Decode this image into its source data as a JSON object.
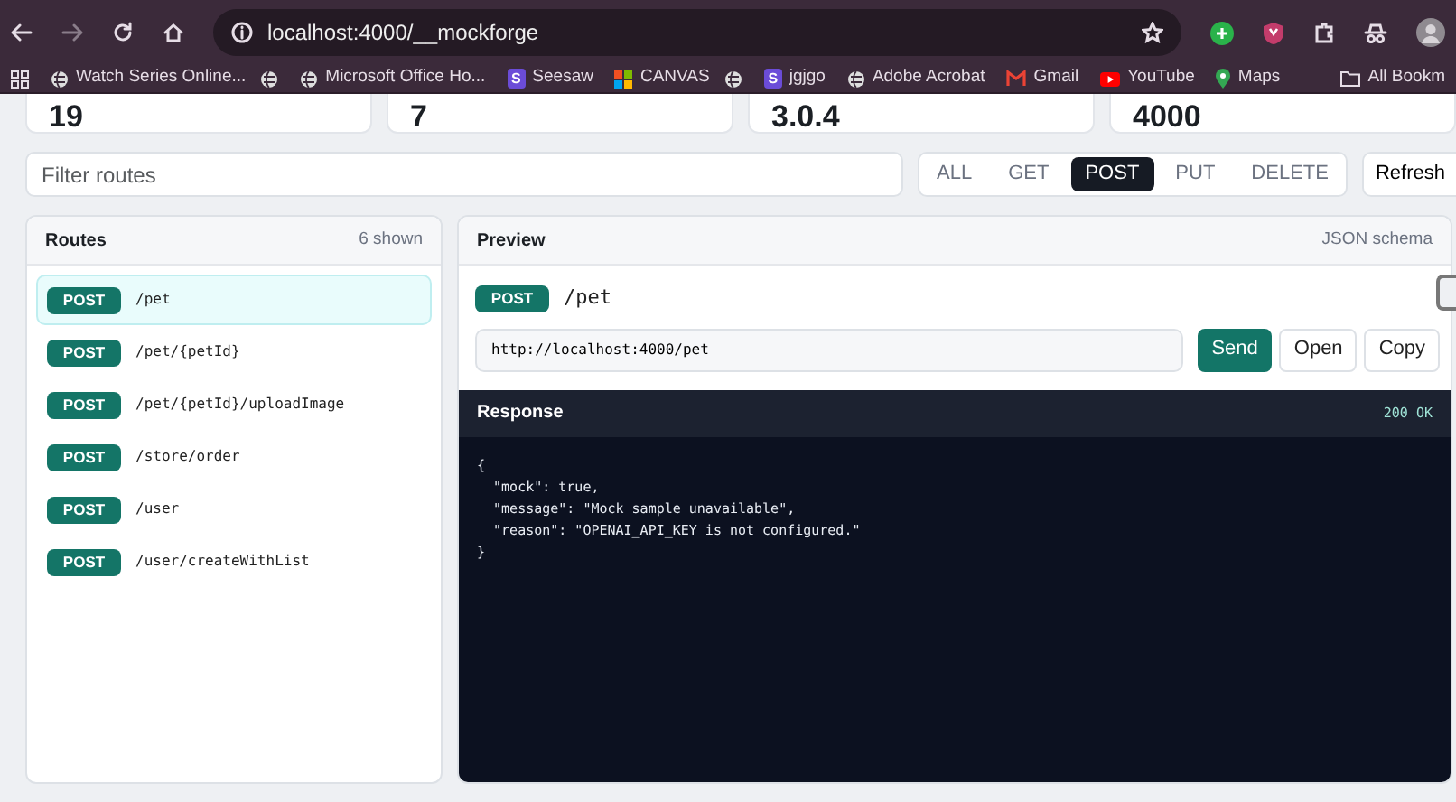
{
  "browser": {
    "url": "localhost:4000/__mockforge",
    "bookmarks": [
      {
        "label": "Watch Series Online...",
        "kind": "globe"
      },
      {
        "kind": "globe"
      },
      {
        "label": "Microsoft Office Ho...",
        "kind": "globe"
      },
      {
        "label": "Seesaw",
        "kind": "letter",
        "letter": "S"
      },
      {
        "label": "CANVAS",
        "kind": "grid"
      },
      {
        "kind": "globe"
      },
      {
        "label": "jgjgo",
        "kind": "letter",
        "letter": "S"
      },
      {
        "label": "Adobe Acrobat",
        "kind": "globe"
      },
      {
        "label": "Gmail",
        "kind": "mail"
      },
      {
        "label": "YouTube",
        "kind": "video"
      },
      {
        "label": "Maps",
        "kind": "pin"
      }
    ],
    "all_bookmarks": "All Bookm"
  },
  "stats": [
    "19",
    "7",
    "3.0.4",
    "4000"
  ],
  "filter": {
    "placeholder": "Filter routes"
  },
  "methods": [
    {
      "label": "ALL",
      "selected": false
    },
    {
      "label": "GET",
      "selected": false
    },
    {
      "label": "POST",
      "selected": true
    },
    {
      "label": "PUT",
      "selected": false
    },
    {
      "label": "DELETE",
      "selected": false
    }
  ],
  "refresh": "Refresh",
  "routes": {
    "title": "Routes",
    "count": "6 shown",
    "items": [
      {
        "method": "POST",
        "path": "/pet",
        "selected": true
      },
      {
        "method": "POST",
        "path": "/pet/{petId}",
        "selected": false
      },
      {
        "method": "POST",
        "path": "/pet/{petId}/uploadImage",
        "selected": false
      },
      {
        "method": "POST",
        "path": "/store/order",
        "selected": false
      },
      {
        "method": "POST",
        "path": "/user",
        "selected": false
      },
      {
        "method": "POST",
        "path": "/user/createWithList",
        "selected": false
      }
    ]
  },
  "preview": {
    "title": "Preview",
    "schema": "JSON schema",
    "method": "POST",
    "path": "/pet",
    "url": "http://localhost:4000/pet",
    "buttons": [
      {
        "label": "Send",
        "kind": "primary"
      },
      {
        "label": "Open",
        "kind": "plain"
      },
      {
        "label": "Copy",
        "kind": "plain"
      }
    ],
    "response": {
      "title": "Response",
      "status": "200 OK",
      "lines": [
        "{",
        "  \"mock\": true,",
        "  \"message\": \"Mock sample unavailable\",",
        "  \"reason\": \"OPENAI_API_KEY is not configured.\"",
        "}"
      ]
    }
  }
}
